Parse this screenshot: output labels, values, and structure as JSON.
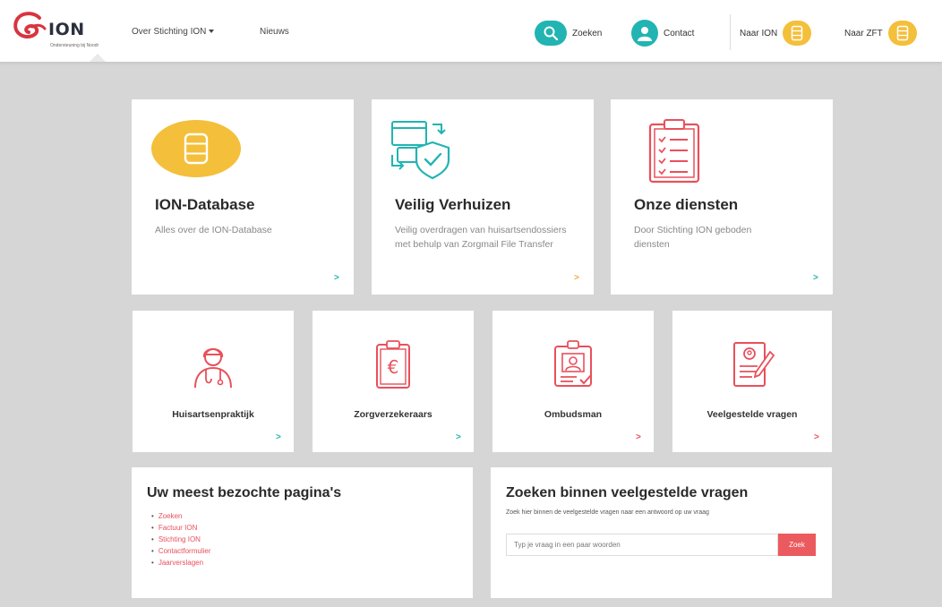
{
  "colors": {
    "teal": "#21b4b2",
    "yellow": "#f4bf3a",
    "red": "#e8505b",
    "orange": "#f4a93a",
    "background": "#d6d6d6"
  },
  "header": {
    "logo_text": "ION",
    "logo_subtext": "Ondersteuning bij Noodr",
    "nav": [
      {
        "label": "Over Stichting ION"
      },
      {
        "label": "Nieuws"
      }
    ],
    "buttons": {
      "search": {
        "label": "Zoeken",
        "icon": "search-icon"
      },
      "contact": {
        "label": "Contact",
        "icon": "user-icon"
      },
      "to_ion": {
        "label": "Naar ION",
        "icon": "database-icon"
      },
      "to_zft": {
        "label": "Naar ZFT",
        "icon": "database-icon"
      }
    }
  },
  "big_cards": [
    {
      "title": "ION-Database",
      "description": "Alles over de ION-Database",
      "icon": "database-icon",
      "arrow": ">"
    },
    {
      "title": "Veilig Verhuizen",
      "description": "Veilig overdragen van huisartsendossiers met behulp van Zorgmail File Transfer",
      "icon": "secure-transfer-icon",
      "arrow": ">"
    },
    {
      "title": "Onze diensten",
      "description": "Door Stichting ION geboden diensten",
      "icon": "clipboard-checklist-icon",
      "arrow": ">"
    }
  ],
  "small_cards": [
    {
      "title": "Huisartsenpraktijk",
      "icon": "doctor-icon",
      "arrow": ">"
    },
    {
      "title": "Zorgverzekeraars",
      "icon": "euro-clipboard-icon",
      "arrow": ">"
    },
    {
      "title": "Ombudsman",
      "icon": "id-badge-icon",
      "arrow": ">"
    },
    {
      "title": "Veelgestelde vragen",
      "icon": "document-pen-icon",
      "arrow": ">"
    }
  ],
  "popular": {
    "title": "Uw meest bezochte pagina's",
    "links": [
      "Zoeken",
      "Factuur ION",
      "Stichting ION",
      "Contactformulier",
      "Jaarverslagen"
    ]
  },
  "faq_search": {
    "title": "Zoeken binnen veelgestelde vragen",
    "description": "Zoek hier binnen de veelgestelde vragen naar een antwoord op uw vraag",
    "placeholder": "Typ je vraag in een paar woorden",
    "button_label": "Zoek"
  }
}
